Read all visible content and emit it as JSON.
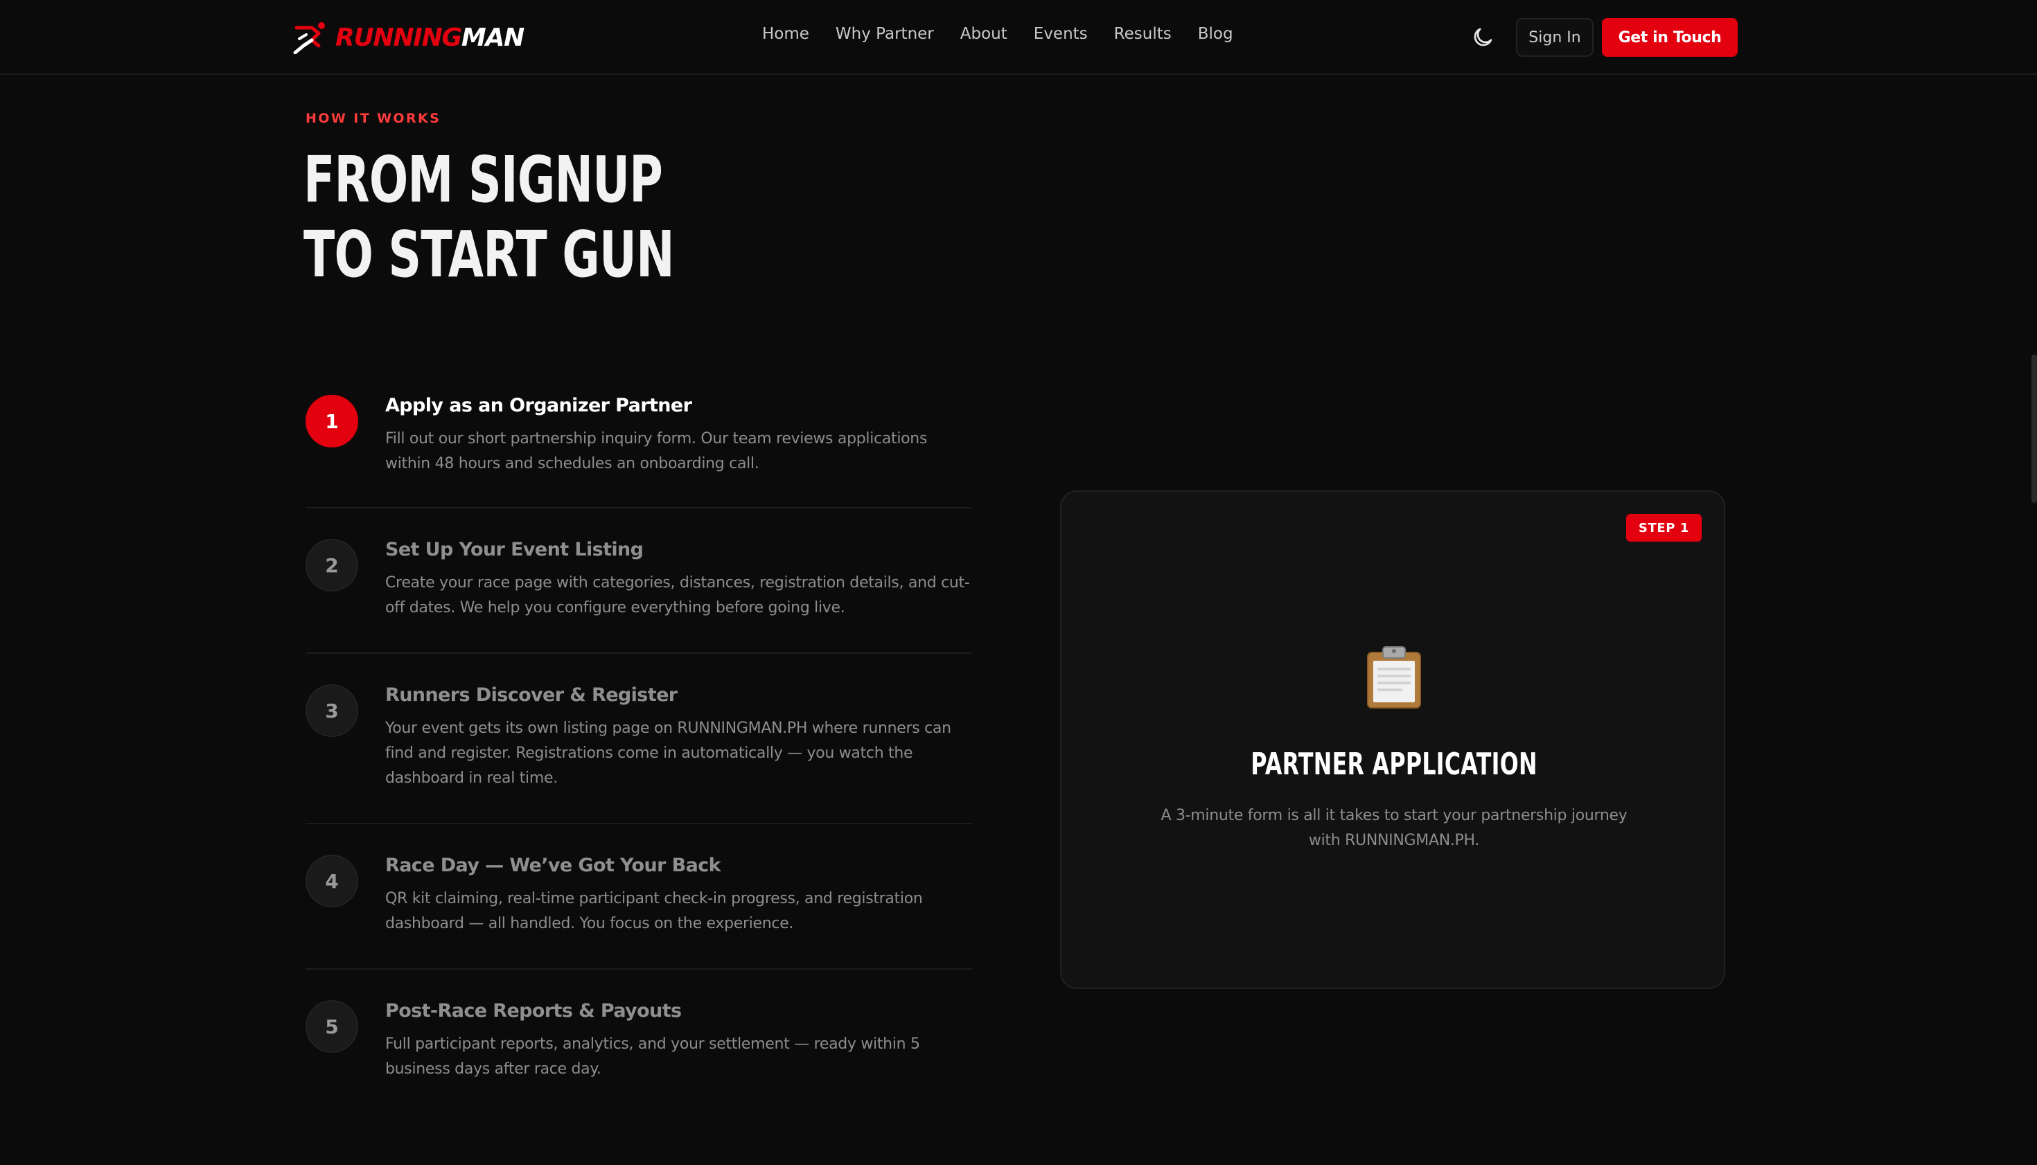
{
  "brand": {
    "part1": "RUNNING",
    "part2": "MAN",
    "accent": "#e3000f"
  },
  "nav": {
    "items": [
      "Home",
      "Why Partner",
      "About",
      "Events",
      "Results",
      "Blog"
    ],
    "theme_icon": "moon-icon",
    "signin": "Sign In",
    "cta": "Get in Touch"
  },
  "hero": {
    "eyebrow": "HOW IT WORKS",
    "line1": "FROM SIGNUP",
    "line2": "TO START GUN"
  },
  "steps": [
    {
      "number": "1",
      "title": "Apply as an Organizer Partner",
      "desc": "Fill out our short partnership inquiry form. Our team reviews applications within 48 hours and schedules an onboarding call.",
      "active": true
    },
    {
      "number": "2",
      "title": "Set Up Your Event Listing",
      "desc": "Create your race page with categories, distances, registration details, and cut-off dates. We help you configure everything before going live.",
      "active": false
    },
    {
      "number": "3",
      "title": "Runners Discover & Register",
      "desc": "Your event gets its own listing page on RUNNINGMAN.PH where runners can find and register. Registrations come in automatically — you watch the dashboard in real time.",
      "active": false
    },
    {
      "number": "4",
      "title": "Race Day — We’ve Got Your Back",
      "desc": "QR kit claiming, real-time participant check-in progress, and registration dashboard — all handled. You focus on the experience.",
      "active": false
    },
    {
      "number": "5",
      "title": "Post-Race Reports & Payouts",
      "desc": "Full participant reports, analytics, and your settlement — ready within 5 business days after race day.",
      "active": false
    }
  ],
  "card": {
    "badge": "STEP 1",
    "icon": "clipboard-icon",
    "title": "PARTNER APPLICATION",
    "desc": "A 3-minute form is all it takes to start your partnership journey with RUNNINGMAN.PH."
  }
}
